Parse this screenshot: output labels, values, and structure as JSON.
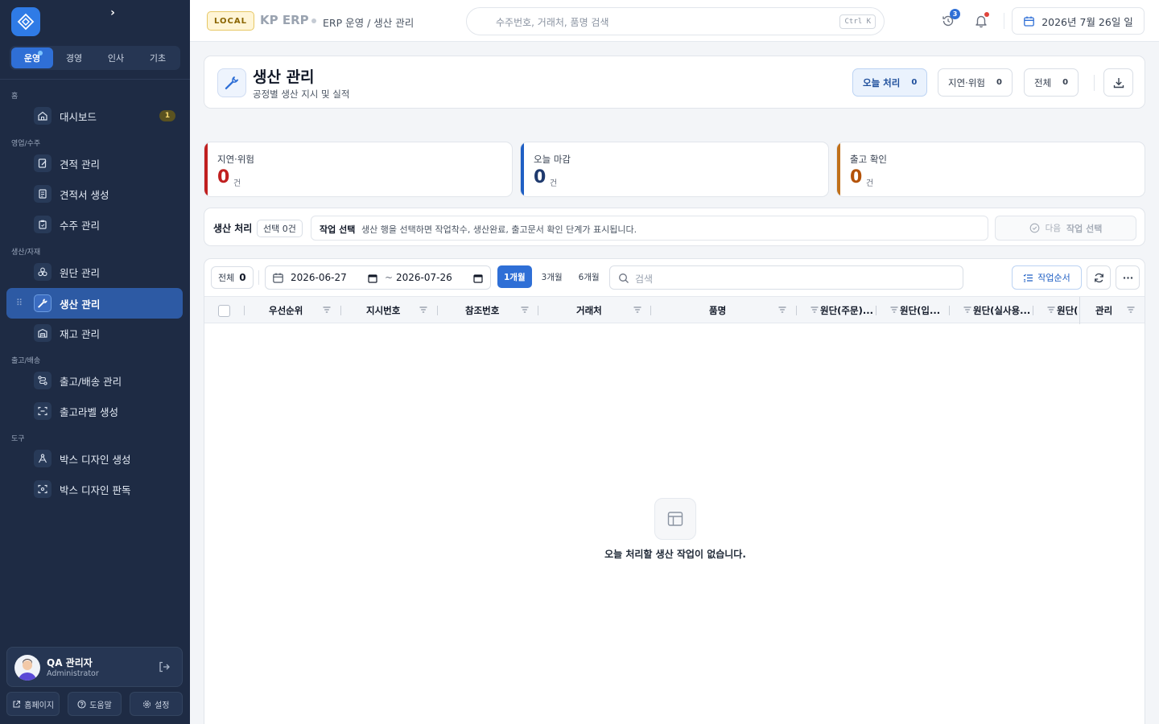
{
  "sidebar": {
    "collapse_glyph": "›",
    "mode_tabs": [
      "운영",
      "경영",
      "인사",
      "기초"
    ],
    "sections": {
      "home": "홈",
      "sales": "영업/수주",
      "production": "생산/자재",
      "shipping": "출고/배송",
      "tools": "도구"
    },
    "items": [
      {
        "label": "대시보드",
        "icon": "home-icon",
        "badge": "1"
      },
      {
        "label": "견적 관리",
        "icon": "edit-doc-icon"
      },
      {
        "label": "견적서 생성",
        "icon": "doc-create-icon"
      },
      {
        "label": "수주 관리",
        "icon": "clipboard-icon"
      },
      {
        "label": "원단 관리",
        "icon": "fabric-icon"
      },
      {
        "label": "생산 관리",
        "icon": "wrench-icon",
        "active": true
      },
      {
        "label": "재고 관리",
        "icon": "warehouse-icon"
      },
      {
        "label": "출고/배송 관리",
        "icon": "route-icon"
      },
      {
        "label": "출고라벨 생성",
        "icon": "scan-label-icon"
      },
      {
        "label": "박스 디자인 생성",
        "icon": "design-icon"
      },
      {
        "label": "박스 디자인 판독",
        "icon": "scan-eye-icon"
      }
    ],
    "user": {
      "name": "QA 관리자",
      "role": "Administrator"
    },
    "footer_buttons": [
      "홈페이지",
      "도움말",
      "설정"
    ]
  },
  "topbar": {
    "env": "LOCAL",
    "app_name": "KP ERP",
    "breadcrumb": "ERP 운영 / 생산 관리",
    "search_placeholder": "수주번호, 거래처, 품명 검색",
    "shortcut": "Ctrl K",
    "notification_count": "3",
    "date": "2026년 7월 26일 일"
  },
  "header": {
    "title": "생산 관리",
    "subtitle": "공정별 생산 지시 및 실적",
    "filters": [
      {
        "label": "오늘 처리",
        "count": "0"
      },
      {
        "label": "지연·위험",
        "count": "0"
      },
      {
        "label": "전체",
        "count": "0"
      }
    ]
  },
  "stats": [
    {
      "label": "지연·위험",
      "value": "0",
      "unit": "건",
      "color": "#c01f1f"
    },
    {
      "label": "오늘 마감",
      "value": "0",
      "unit": "건",
      "color": "#1f3a6e"
    },
    {
      "label": "출고 확인",
      "value": "0",
      "unit": "건",
      "color": "#b45309"
    }
  ],
  "action_bar": {
    "title": "생산 처리",
    "selection": "선택 0건",
    "task_label": "작업 선택",
    "task_hint": "생산 행을 선택하면 작업착수, 생산완료, 출고문서 확인 단계가 표시됩니다.",
    "next_prefix": "다음",
    "next_label": "작업 선택"
  },
  "table": {
    "total_label": "전체",
    "total_count": "0",
    "date_from": "2026-06-27",
    "date_to": "2026-07-26",
    "date_sep": "~",
    "ranges": [
      "1개월",
      "3개월",
      "6개월"
    ],
    "search_placeholder": "검색",
    "order_button": "작업순서",
    "columns": [
      "우선순위",
      "지시번호",
      "참조번호",
      "거래처",
      "품명",
      "원단(주문)...",
      "원단(입...",
      "원단(실사용...",
      "원단(",
      "관리"
    ],
    "empty_message": "오늘 처리할 생산 작업이 없습니다."
  },
  "colors": {
    "sidebar_bg": "#1e2b44",
    "accent": "#2f6fd6",
    "danger": "#c01f1f",
    "warning": "#b45309"
  }
}
